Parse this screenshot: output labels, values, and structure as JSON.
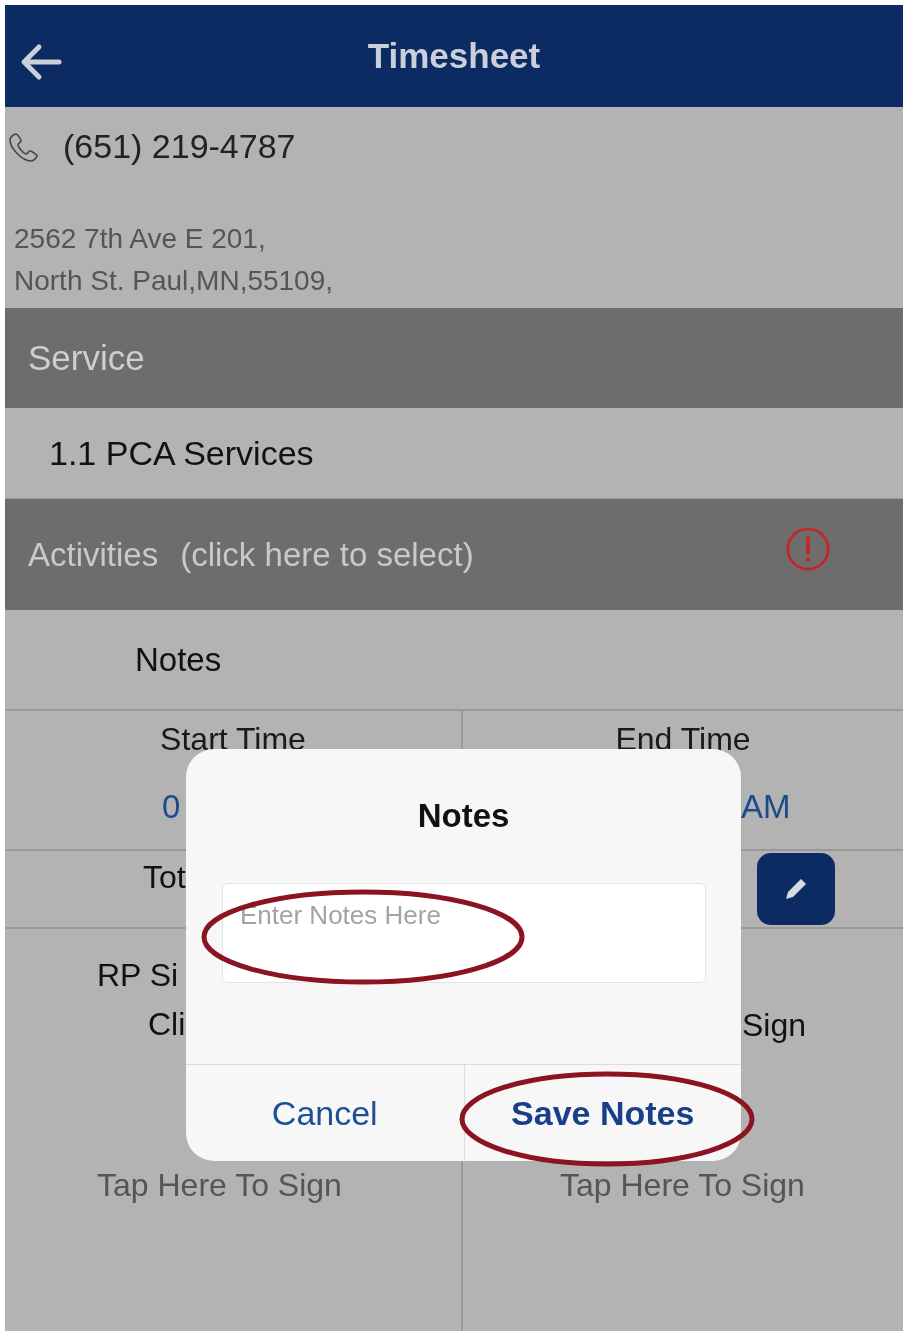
{
  "header": {
    "title": "Timesheet"
  },
  "contact": {
    "phone": "(651) 219-4787",
    "address_lines": [
      "2562 7th Ave E 201,",
      "North St. Paul,MN,55109,"
    ]
  },
  "service": {
    "heading": "Service",
    "value": "1.1 PCA Services"
  },
  "activities": {
    "label": "Activities",
    "hint": "(click here to select)",
    "warning": true
  },
  "notes_row": {
    "label": "Notes"
  },
  "times": {
    "columns": [
      {
        "heading": "Start Time",
        "value": "0"
      },
      {
        "heading": "End Time",
        "value": "AM"
      }
    ]
  },
  "total": {
    "label": "Tot"
  },
  "signatures": [
    {
      "lines": [
        "RP Si",
        "Cli"
      ],
      "tap": "Tap Here To Sign"
    },
    {
      "lines": [
        "Sign"
      ],
      "tap": "Tap Here To Sign"
    }
  ],
  "dialog": {
    "title": "Notes",
    "input": {
      "placeholder": "Enter Notes Here"
    },
    "buttons": [
      {
        "label": "Cancel",
        "primary": false,
        "highlighted": false
      },
      {
        "label": "Save Notes",
        "primary": true,
        "highlighted": true
      }
    ],
    "input_highlighted": true
  }
}
